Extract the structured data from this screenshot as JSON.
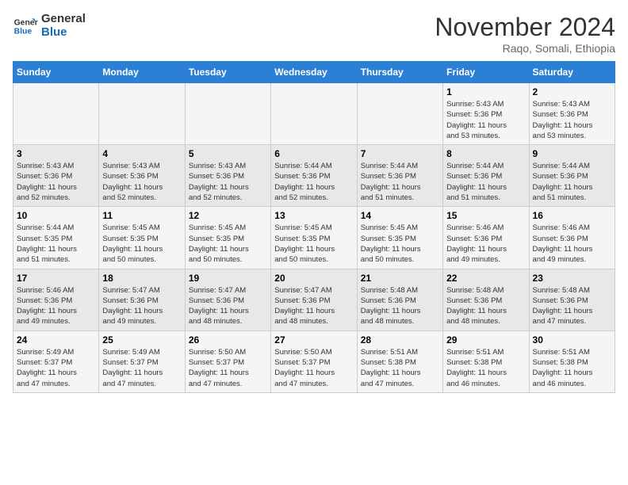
{
  "header": {
    "logo_line1": "General",
    "logo_line2": "Blue",
    "month": "November 2024",
    "location": "Raqo, Somali, Ethiopia"
  },
  "weekdays": [
    "Sunday",
    "Monday",
    "Tuesday",
    "Wednesday",
    "Thursday",
    "Friday",
    "Saturday"
  ],
  "weeks": [
    [
      {
        "day": "",
        "info": ""
      },
      {
        "day": "",
        "info": ""
      },
      {
        "day": "",
        "info": ""
      },
      {
        "day": "",
        "info": ""
      },
      {
        "day": "",
        "info": ""
      },
      {
        "day": "1",
        "info": "Sunrise: 5:43 AM\nSunset: 5:36 PM\nDaylight: 11 hours\nand 53 minutes."
      },
      {
        "day": "2",
        "info": "Sunrise: 5:43 AM\nSunset: 5:36 PM\nDaylight: 11 hours\nand 53 minutes."
      }
    ],
    [
      {
        "day": "3",
        "info": "Sunrise: 5:43 AM\nSunset: 5:36 PM\nDaylight: 11 hours\nand 52 minutes."
      },
      {
        "day": "4",
        "info": "Sunrise: 5:43 AM\nSunset: 5:36 PM\nDaylight: 11 hours\nand 52 minutes."
      },
      {
        "day": "5",
        "info": "Sunrise: 5:43 AM\nSunset: 5:36 PM\nDaylight: 11 hours\nand 52 minutes."
      },
      {
        "day": "6",
        "info": "Sunrise: 5:44 AM\nSunset: 5:36 PM\nDaylight: 11 hours\nand 52 minutes."
      },
      {
        "day": "7",
        "info": "Sunrise: 5:44 AM\nSunset: 5:36 PM\nDaylight: 11 hours\nand 51 minutes."
      },
      {
        "day": "8",
        "info": "Sunrise: 5:44 AM\nSunset: 5:36 PM\nDaylight: 11 hours\nand 51 minutes."
      },
      {
        "day": "9",
        "info": "Sunrise: 5:44 AM\nSunset: 5:36 PM\nDaylight: 11 hours\nand 51 minutes."
      }
    ],
    [
      {
        "day": "10",
        "info": "Sunrise: 5:44 AM\nSunset: 5:35 PM\nDaylight: 11 hours\nand 51 minutes."
      },
      {
        "day": "11",
        "info": "Sunrise: 5:45 AM\nSunset: 5:35 PM\nDaylight: 11 hours\nand 50 minutes."
      },
      {
        "day": "12",
        "info": "Sunrise: 5:45 AM\nSunset: 5:35 PM\nDaylight: 11 hours\nand 50 minutes."
      },
      {
        "day": "13",
        "info": "Sunrise: 5:45 AM\nSunset: 5:35 PM\nDaylight: 11 hours\nand 50 minutes."
      },
      {
        "day": "14",
        "info": "Sunrise: 5:45 AM\nSunset: 5:35 PM\nDaylight: 11 hours\nand 50 minutes."
      },
      {
        "day": "15",
        "info": "Sunrise: 5:46 AM\nSunset: 5:36 PM\nDaylight: 11 hours\nand 49 minutes."
      },
      {
        "day": "16",
        "info": "Sunrise: 5:46 AM\nSunset: 5:36 PM\nDaylight: 11 hours\nand 49 minutes."
      }
    ],
    [
      {
        "day": "17",
        "info": "Sunrise: 5:46 AM\nSunset: 5:36 PM\nDaylight: 11 hours\nand 49 minutes."
      },
      {
        "day": "18",
        "info": "Sunrise: 5:47 AM\nSunset: 5:36 PM\nDaylight: 11 hours\nand 49 minutes."
      },
      {
        "day": "19",
        "info": "Sunrise: 5:47 AM\nSunset: 5:36 PM\nDaylight: 11 hours\nand 48 minutes."
      },
      {
        "day": "20",
        "info": "Sunrise: 5:47 AM\nSunset: 5:36 PM\nDaylight: 11 hours\nand 48 minutes."
      },
      {
        "day": "21",
        "info": "Sunrise: 5:48 AM\nSunset: 5:36 PM\nDaylight: 11 hours\nand 48 minutes."
      },
      {
        "day": "22",
        "info": "Sunrise: 5:48 AM\nSunset: 5:36 PM\nDaylight: 11 hours\nand 48 minutes."
      },
      {
        "day": "23",
        "info": "Sunrise: 5:48 AM\nSunset: 5:36 PM\nDaylight: 11 hours\nand 47 minutes."
      }
    ],
    [
      {
        "day": "24",
        "info": "Sunrise: 5:49 AM\nSunset: 5:37 PM\nDaylight: 11 hours\nand 47 minutes."
      },
      {
        "day": "25",
        "info": "Sunrise: 5:49 AM\nSunset: 5:37 PM\nDaylight: 11 hours\nand 47 minutes."
      },
      {
        "day": "26",
        "info": "Sunrise: 5:50 AM\nSunset: 5:37 PM\nDaylight: 11 hours\nand 47 minutes."
      },
      {
        "day": "27",
        "info": "Sunrise: 5:50 AM\nSunset: 5:37 PM\nDaylight: 11 hours\nand 47 minutes."
      },
      {
        "day": "28",
        "info": "Sunrise: 5:51 AM\nSunset: 5:38 PM\nDaylight: 11 hours\nand 47 minutes."
      },
      {
        "day": "29",
        "info": "Sunrise: 5:51 AM\nSunset: 5:38 PM\nDaylight: 11 hours\nand 46 minutes."
      },
      {
        "day": "30",
        "info": "Sunrise: 5:51 AM\nSunset: 5:38 PM\nDaylight: 11 hours\nand 46 minutes."
      }
    ]
  ]
}
